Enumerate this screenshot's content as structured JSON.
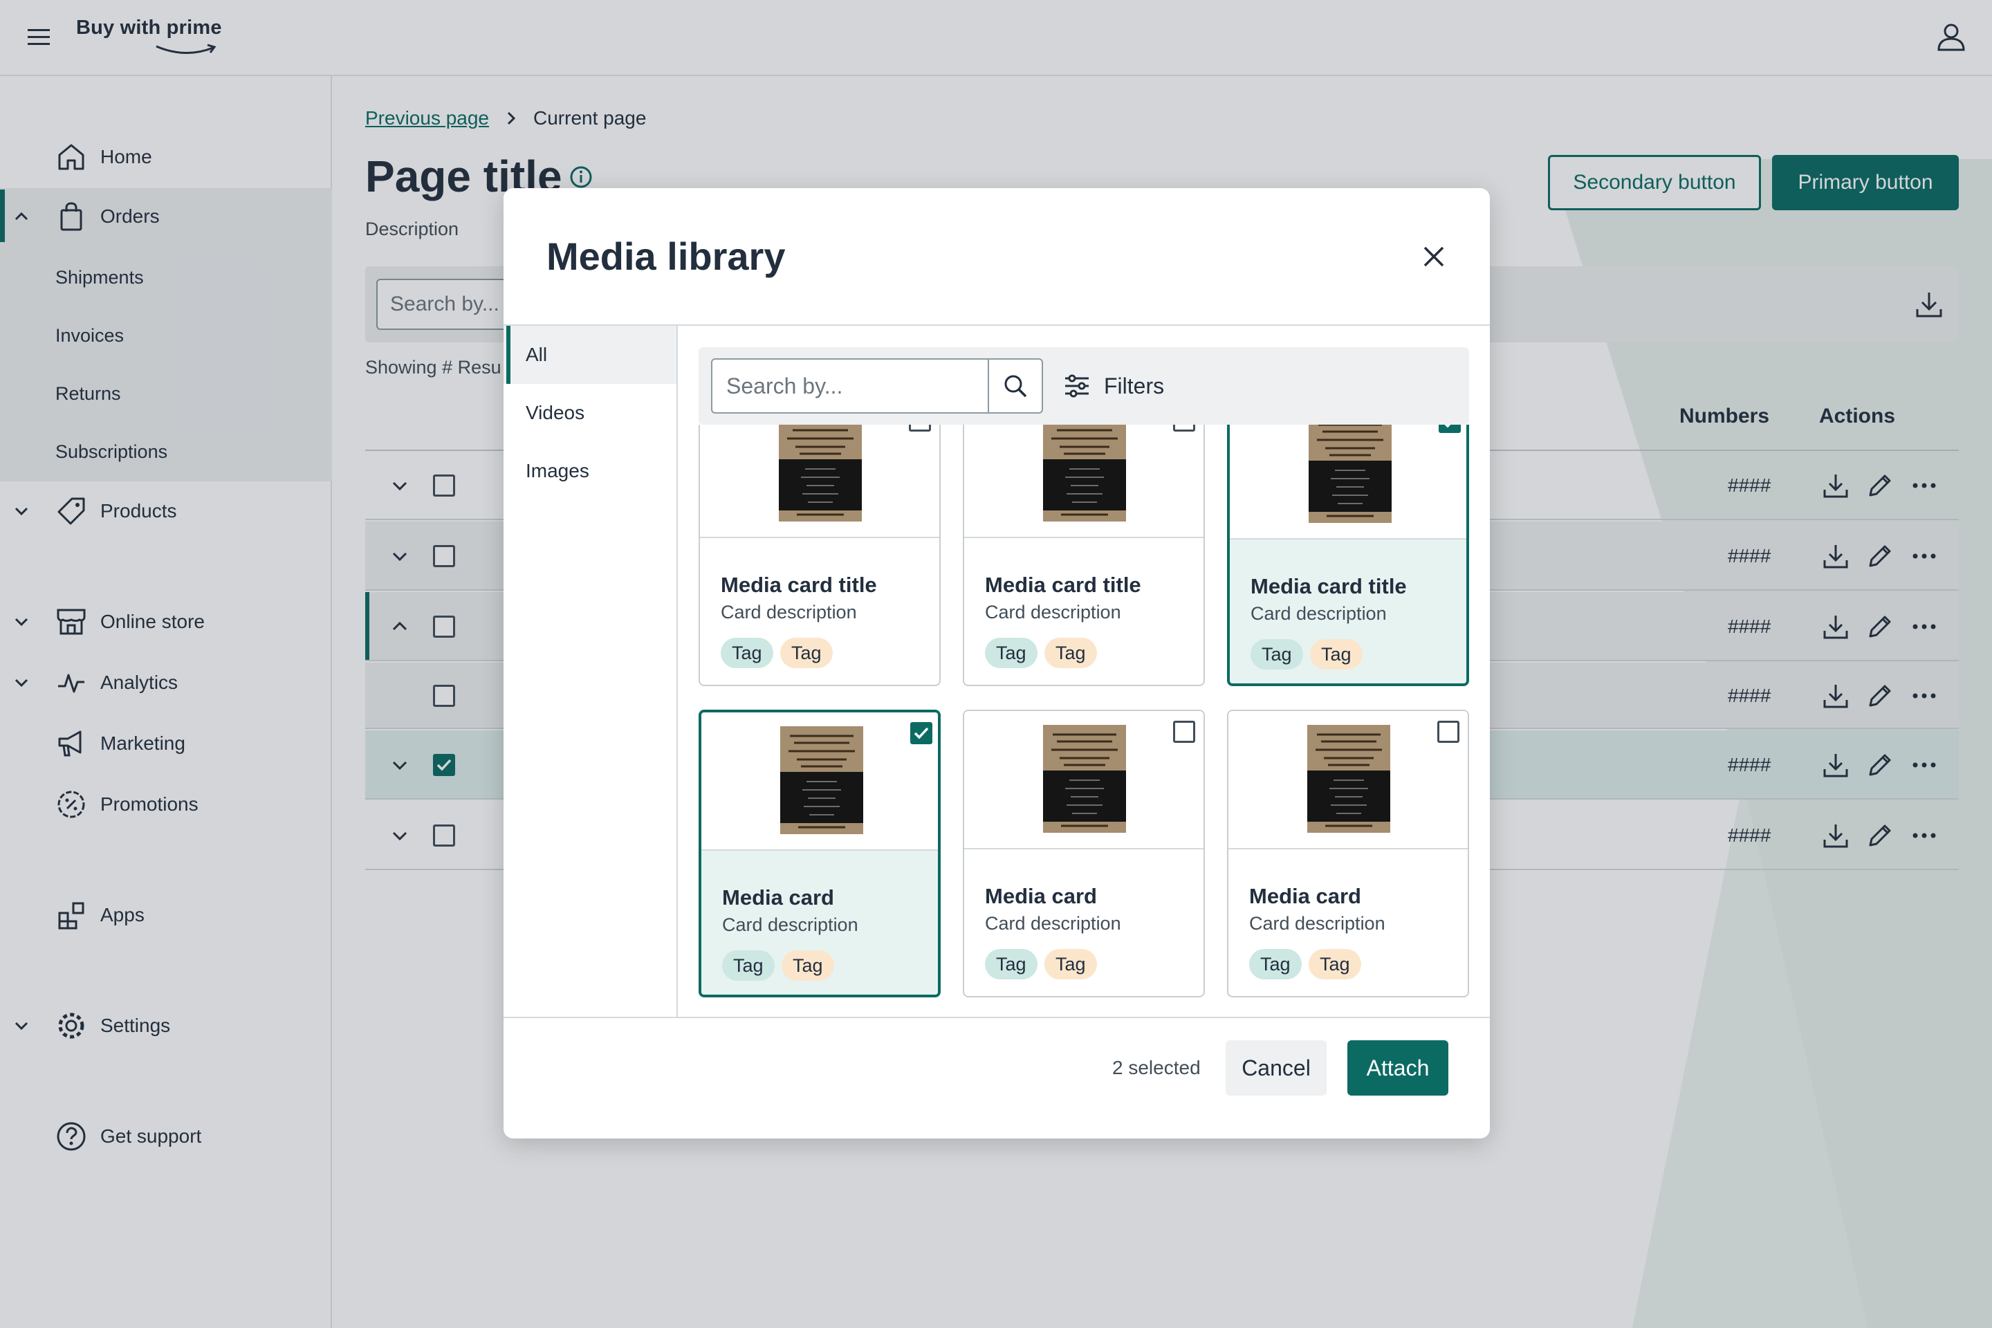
{
  "header": {
    "logo_text": "Buy with prime",
    "menu_icon": "hamburger-icon",
    "account_icon": "user-icon"
  },
  "sidebar": {
    "items": [
      {
        "label": "Home",
        "icon": "home-icon"
      },
      {
        "label": "Orders",
        "icon": "shopping-bag-icon"
      },
      {
        "label": "Products",
        "icon": "tag-icon"
      },
      {
        "label": "Online store",
        "icon": "storefront-icon"
      },
      {
        "label": "Analytics",
        "icon": "analytics-icon"
      },
      {
        "label": "Marketing",
        "icon": "megaphone-icon"
      },
      {
        "label": "Promotions",
        "icon": "promotion-badge-icon"
      },
      {
        "label": "Apps",
        "icon": "apps-grid-icon"
      },
      {
        "label": "Settings",
        "icon": "gear-icon"
      },
      {
        "label": "Get support",
        "icon": "help-icon"
      }
    ],
    "orders_subitems": [
      "Shipments",
      "Invoices",
      "Returns",
      "Subscriptions"
    ]
  },
  "page": {
    "breadcrumb_prev": "Previous page",
    "breadcrumb_current": "Current page",
    "title": "Page title",
    "description": "Description",
    "secondary_button": "Secondary button",
    "primary_button": "Primary button",
    "search_placeholder": "Search by...",
    "showing_text": "Showing # Resu",
    "columns": {
      "numbers": "Numbers",
      "actions": "Actions"
    },
    "rows": [
      {
        "number": "####",
        "checked": false
      },
      {
        "number": "####",
        "checked": false
      },
      {
        "number": "####",
        "checked": false
      },
      {
        "number": "####",
        "checked": false
      },
      {
        "number": "####",
        "checked": true
      },
      {
        "number": "####",
        "checked": false
      }
    ]
  },
  "modal": {
    "title": "Media library",
    "tabs": [
      "All",
      "Videos",
      "Images"
    ],
    "search_placeholder": "Search by...",
    "filters_label": "Filters",
    "cards": [
      {
        "title": "Media card title",
        "description": "Card description",
        "tags": [
          "Tag",
          "Tag"
        ],
        "selected": false
      },
      {
        "title": "Media card title",
        "description": "Card description",
        "tags": [
          "Tag",
          "Tag"
        ],
        "selected": false
      },
      {
        "title": "Media card title",
        "description": "Card description",
        "tags": [
          "Tag",
          "Tag"
        ],
        "selected": true
      },
      {
        "title": "Media card",
        "description": "Card description",
        "tags": [
          "Tag",
          "Tag"
        ],
        "selected": true
      },
      {
        "title": "Media card",
        "description": "Card description",
        "tags": [
          "Tag",
          "Tag"
        ],
        "selected": false
      },
      {
        "title": "Media card",
        "description": "Card description",
        "tags": [
          "Tag",
          "Tag"
        ],
        "selected": false
      }
    ],
    "selected_count": "2 selected",
    "cancel_label": "Cancel",
    "attach_label": "Attach"
  },
  "colors": {
    "accent": "#0b6b63",
    "text": "#232f3e",
    "surface": "#eef0f1",
    "selected_card_bg": "#e7f3f1",
    "tag_teal": "#cde7e3",
    "tag_peach": "#fbe6cc"
  }
}
